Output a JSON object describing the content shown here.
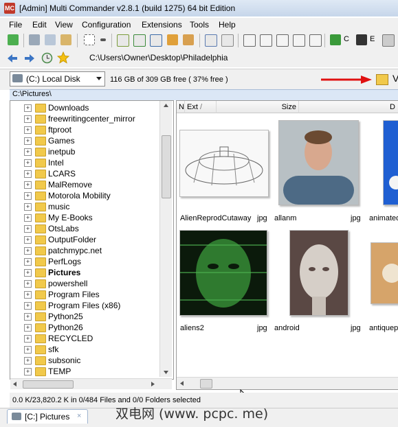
{
  "window": {
    "title": "[Admin] Multi Commander v2.8.1 (build 1275) 64 bit Edition"
  },
  "menu": [
    "File",
    "Edit",
    "View",
    "Configuration",
    "Extensions",
    "Tools",
    "Help"
  ],
  "toolbar": {
    "label_c": "C",
    "label_e": "E"
  },
  "address": {
    "path": "C:\\Users\\Owner\\Desktop\\Philadelphia"
  },
  "drive": {
    "selected": "(C:) Local Disk",
    "free_space": "116 GB of 309 GB free ( 37% free )",
    "cut_label": "V"
  },
  "panel": {
    "path": "C:\\Pictures\\"
  },
  "tree": {
    "items": [
      "Downloads",
      "freewritingcenter_mirror",
      "ftproot",
      "Games",
      "inetpub",
      "Intel",
      "LCARS",
      "MalRemove",
      "Motorola Mobility",
      "music",
      "My E-Books",
      "OtsLabs",
      "OutputFolder",
      "patchmypc.net",
      "PerfLogs",
      "Pictures",
      "powershell",
      "Program Files",
      "Program Files (x86)",
      "Python25",
      "Python26",
      "RECYCLED",
      "sfk",
      "subsonic",
      "TEMP"
    ],
    "selected_index": 15
  },
  "columns": {
    "n": "N",
    "ext": "Ext",
    "sort": "/",
    "size": "Size",
    "date": "D"
  },
  "files": [
    {
      "name": "AlienReprodCutaway",
      "ext": "jpg"
    },
    {
      "name": "allanm",
      "ext": "jpg"
    },
    {
      "name": "animated",
      "ext": ""
    },
    {
      "name": "aliens2",
      "ext": "jpg"
    },
    {
      "name": "android",
      "ext": "jpg"
    },
    {
      "name": "antiquepl",
      "ext": ""
    }
  ],
  "status": {
    "text": "0.0 K/23,820.2 K in 0/484 Files and 0/0 Folders selected"
  },
  "tab": {
    "label": "[C:] Pictures",
    "close": "×"
  },
  "watermark": "双电网 (www. pcpc. me)",
  "colors": {
    "annotation_arrow": "#e01010",
    "folder": "#f1c94b",
    "titlebar": "#dfe9f5",
    "selection": "#dbe7f6"
  }
}
